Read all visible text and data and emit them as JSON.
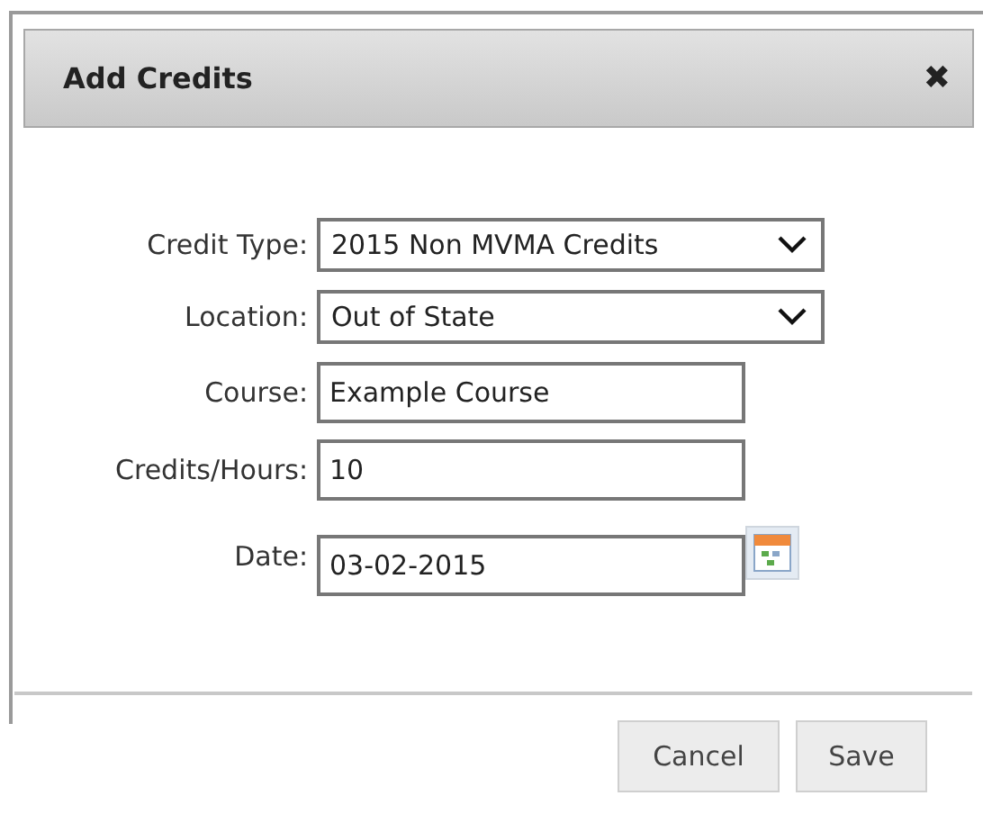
{
  "dialog": {
    "title": "Add Credits",
    "close_icon": "✖"
  },
  "fields": [
    {
      "kind": "select",
      "label": "Credit Type:",
      "value": "2015 Non MVMA Credits"
    },
    {
      "kind": "select",
      "label": "Location:",
      "value": "Out of State"
    },
    {
      "kind": "text",
      "label": "Course:",
      "value": "Example Course"
    },
    {
      "kind": "text",
      "label": "Credits/Hours:",
      "value": "10"
    },
    {
      "kind": "date",
      "label": "Date:",
      "value": "03-02-2015"
    }
  ],
  "buttons": [
    "Cancel",
    "Save"
  ]
}
